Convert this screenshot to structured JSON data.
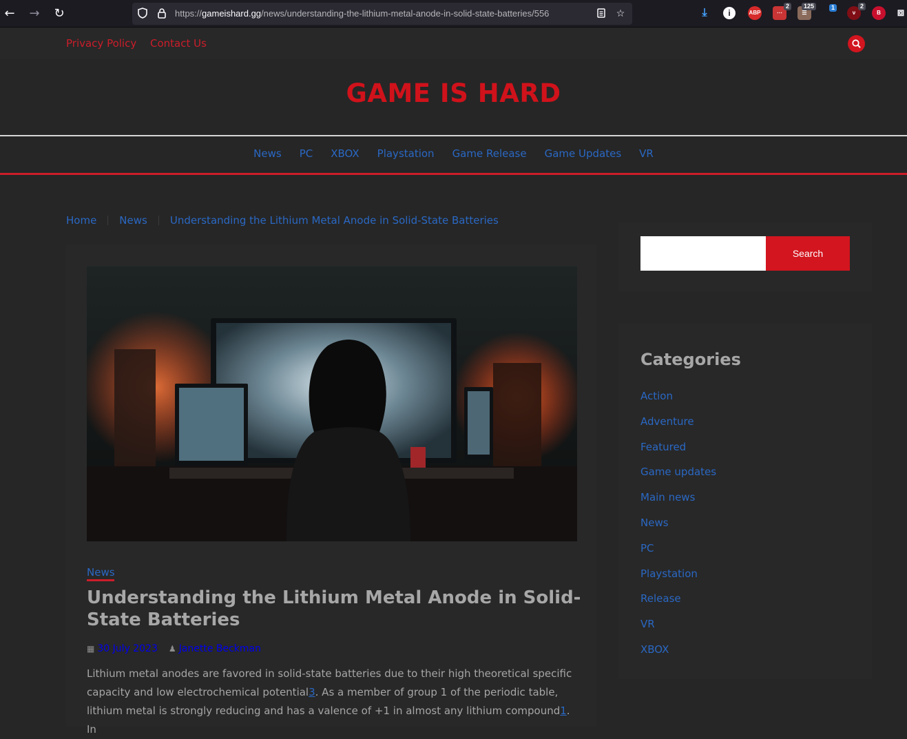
{
  "browser": {
    "url_prefix": "https://",
    "url_host": "gameishard.gg",
    "url_path": "/news/understanding-the-lithium-metal-anode-in-solid-state-batteries/556",
    "ext_abp": "ABP",
    "ext_badge_1": "2",
    "ext_badge_2": "125",
    "ext_badge_3": "1",
    "ext_badge_4": "2",
    "ext_b": "B"
  },
  "topbar": {
    "links": [
      "Privacy Policy",
      "Contact Us"
    ]
  },
  "site": {
    "title": "GAME IS HARD"
  },
  "mainnav": {
    "items": [
      "News",
      "PC",
      "XBOX",
      "Playstation",
      "Game Release",
      "Game Updates",
      "VR"
    ]
  },
  "breadcrumb": {
    "items": [
      "Home",
      "News",
      "Understanding the Lithium Metal Anode in Solid-State Batteries"
    ]
  },
  "article": {
    "category": "News",
    "title": "Understanding the Lithium Metal Anode in Solid-State Batteries",
    "date": "30 July 2023",
    "author": "Janette Beckman",
    "body_1": "Lithium metal anodes are favored in solid-state batteries due to their high theoretical specific capacity and low electrochemical potential",
    "ref_1": "3",
    "body_2": ". As a member of group 1 of the periodic table, lithium metal is strongly reducing and has a valence of +1 in almost any lithium compound",
    "ref_2": "1",
    "body_3": ". In"
  },
  "sidebar": {
    "search_button": "Search",
    "categories_title": "Categories",
    "categories": [
      "Action",
      "Adventure",
      "Featured",
      "Game updates",
      "Main news",
      "News",
      "PC",
      "Playstation",
      "Release",
      "VR",
      "XBOX"
    ]
  },
  "colors": {
    "accent_red": "#d2151f",
    "link_blue": "#2a68c4",
    "background": "#262626"
  }
}
